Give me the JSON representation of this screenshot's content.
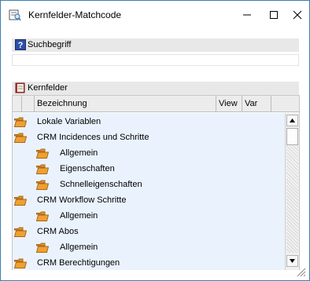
{
  "window": {
    "title": "Kernfelder-Matchcode",
    "app_icon": "search-document-icon",
    "controls": [
      "minimize-icon",
      "maximize-icon",
      "close-icon"
    ]
  },
  "search_section": {
    "label": "Suchbegriff",
    "icon": "help-icon",
    "value": ""
  },
  "fields_section": {
    "label": "Kernfelder",
    "icon": "book-icon"
  },
  "table": {
    "columns": [
      "",
      "",
      "Bezeichnung",
      "View",
      "Var"
    ],
    "rows": [
      {
        "label": "Lokale Variablen",
        "level": 0,
        "icon": "folder-open-icon"
      },
      {
        "label": "CRM Incidences und Schritte",
        "level": 0,
        "icon": "folder-open-icon"
      },
      {
        "label": "Allgemein",
        "level": 1,
        "icon": "folder-open-icon"
      },
      {
        "label": "Eigenschaften",
        "level": 1,
        "icon": "folder-open-icon"
      },
      {
        "label": "Schnelleigenschaften",
        "level": 1,
        "icon": "folder-open-icon"
      },
      {
        "label": "CRM Workflow Schritte",
        "level": 0,
        "icon": "folder-open-icon"
      },
      {
        "label": "Allgemein",
        "level": 1,
        "icon": "folder-open-icon"
      },
      {
        "label": "CRM Abos",
        "level": 0,
        "icon": "folder-open-icon"
      },
      {
        "label": "Allgemein",
        "level": 1,
        "icon": "folder-open-icon"
      },
      {
        "label": "CRM Berechtigungen",
        "level": 0,
        "icon": "folder-open-icon"
      }
    ]
  },
  "colors": {
    "row_bg": "#eaf3fd",
    "header_bg": "#ececec",
    "section_bg": "#e8e8e8",
    "folder": "#f0a030",
    "border": "#3c7fb1"
  }
}
